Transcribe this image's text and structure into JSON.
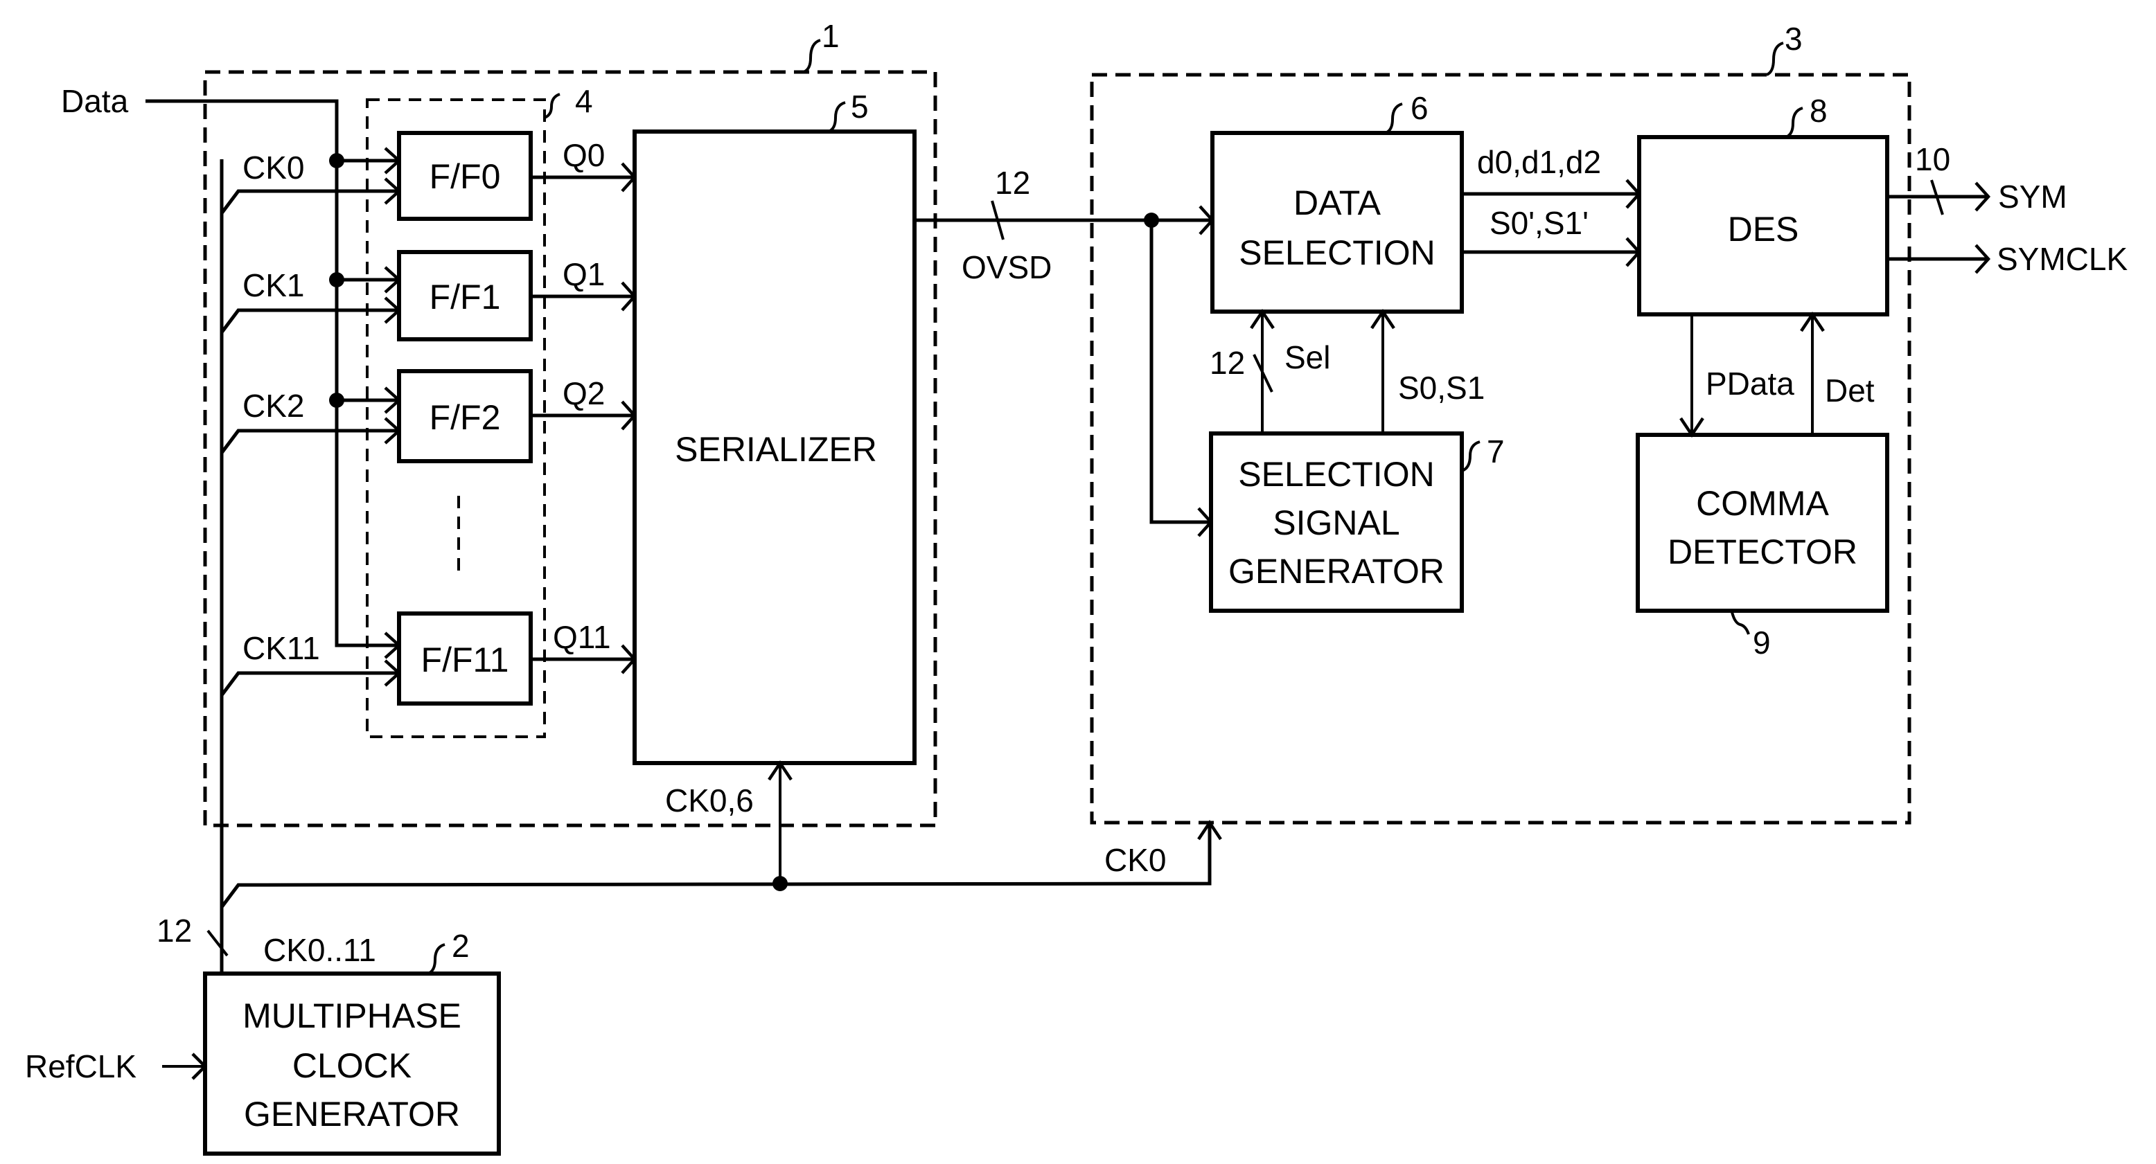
{
  "diagram": {
    "inputs": {
      "data": "Data",
      "refclk": "RefCLK"
    },
    "outputs": {
      "sym": "SYM",
      "symclk": "SYMCLK"
    },
    "blocks": {
      "ff0": "F/F0",
      "ff1": "F/F1",
      "ff2": "F/F2",
      "ff11": "F/F11",
      "serializer": "SERIALIZER",
      "data_selection": [
        "DATA",
        "SELECTION"
      ],
      "des": "DES",
      "selection_signal_generator": [
        "SELECTION",
        "SIGNAL",
        "GENERATOR"
      ],
      "comma_detector": [
        "COMMA",
        "DETECTOR"
      ],
      "multiphase_clock_generator": [
        "MULTIPHASE",
        "CLOCK",
        "GENERATOR"
      ]
    },
    "reference_numerals": {
      "transmitter": "1",
      "clock_generator": "2",
      "receiver": "3",
      "ff_group": "4",
      "serializer": "5",
      "data_selection": "6",
      "selection_signal_generator": "7",
      "des": "8",
      "comma_detector": "9",
      "sym_bus": "10"
    },
    "signals": {
      "ck0": "CK0",
      "ck1": "CK1",
      "ck2": "CK2",
      "ck11": "CK11",
      "q0": "Q0",
      "q1": "Q1",
      "q2": "Q2",
      "q11": "Q11",
      "ovsd": "OVSD",
      "ovsd_width": "12",
      "d_signals": "d0,d1,d2",
      "s_prime": "S0',S1'",
      "sel": "Sel",
      "sel_width": "12",
      "s_signals": "S0,S1",
      "pdata": "PData",
      "det": "Det",
      "ck0_6": "CK0,6",
      "ck0_bottom": "CK0",
      "ck0_11": "CK0..11",
      "clk_bus_width": "12"
    }
  }
}
